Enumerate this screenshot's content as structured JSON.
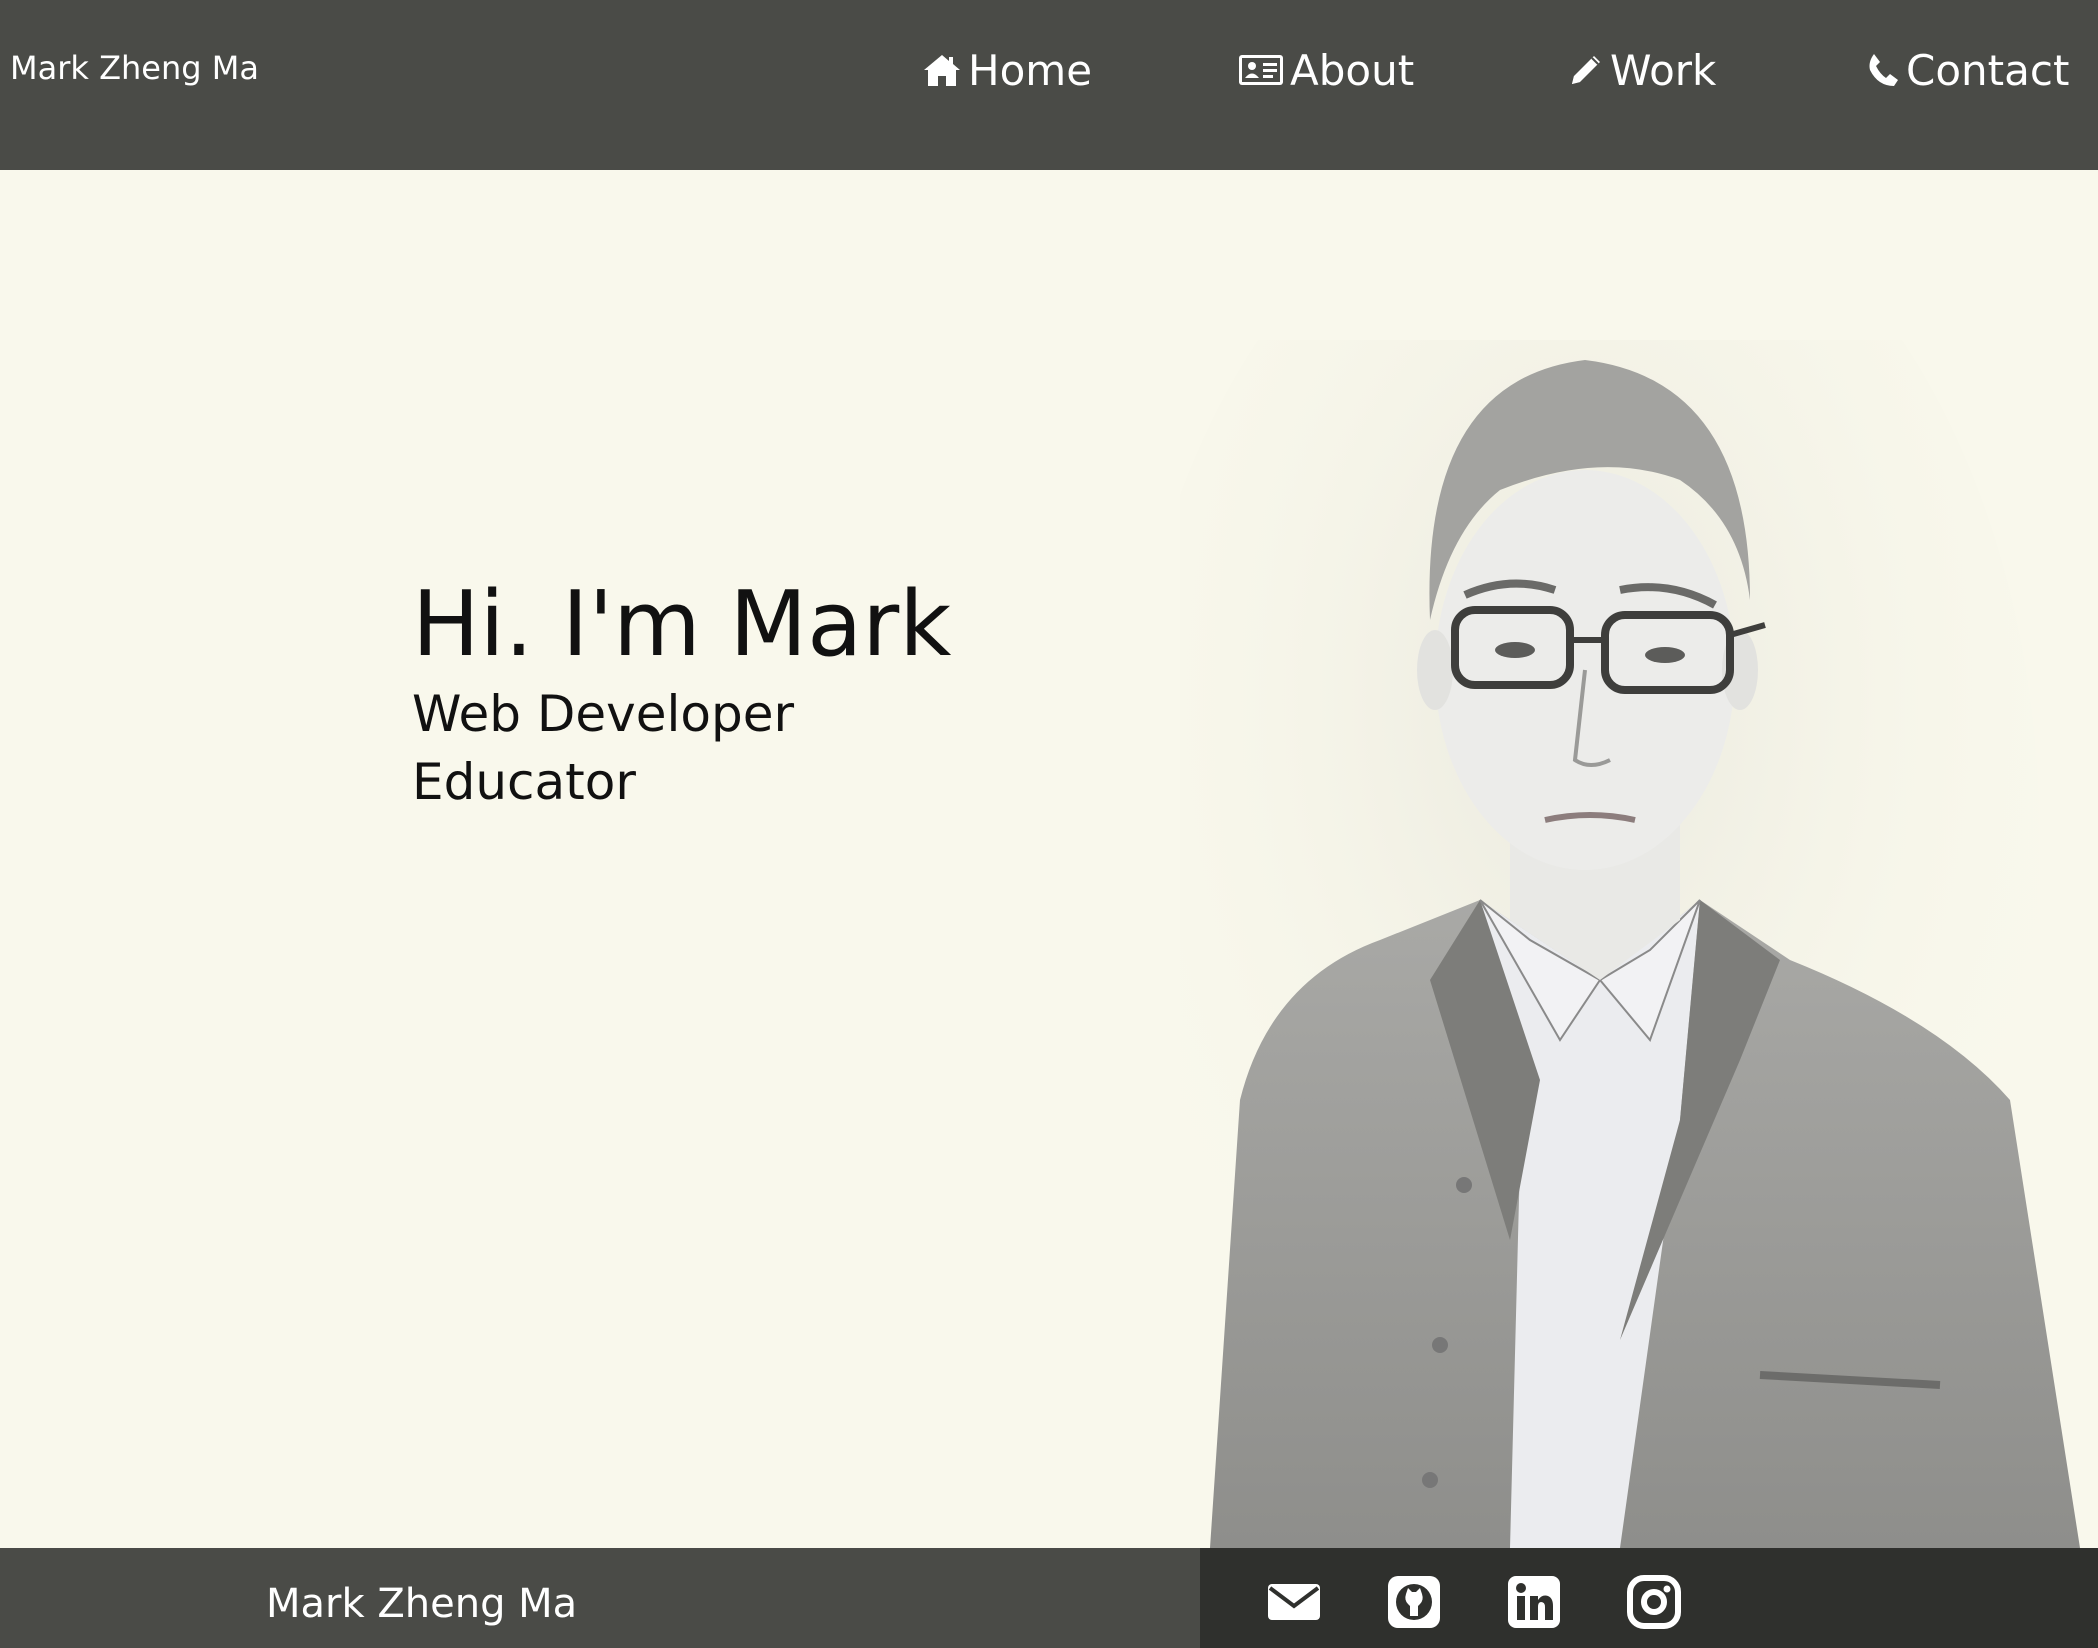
{
  "navbar": {
    "brand": "Mark Zheng Ma",
    "items": [
      {
        "label": "Home",
        "icon": "home-icon"
      },
      {
        "label": "About",
        "icon": "id-card-icon"
      },
      {
        "label": "Work",
        "icon": "pencil-icon"
      },
      {
        "label": "Contact",
        "icon": "phone-icon"
      }
    ]
  },
  "hero": {
    "title": "Hi. I'm Mark",
    "roles": [
      "Web Developer",
      "Educator"
    ]
  },
  "footer": {
    "name": "Mark Zheng Ma",
    "social": [
      "envelope-icon",
      "github-icon",
      "linkedin-icon",
      "instagram-icon"
    ]
  },
  "colors": {
    "background": "#f9f8ec",
    "navbar": "#4a4b47",
    "footer_dark": "#2f302d",
    "text": "#111111"
  }
}
